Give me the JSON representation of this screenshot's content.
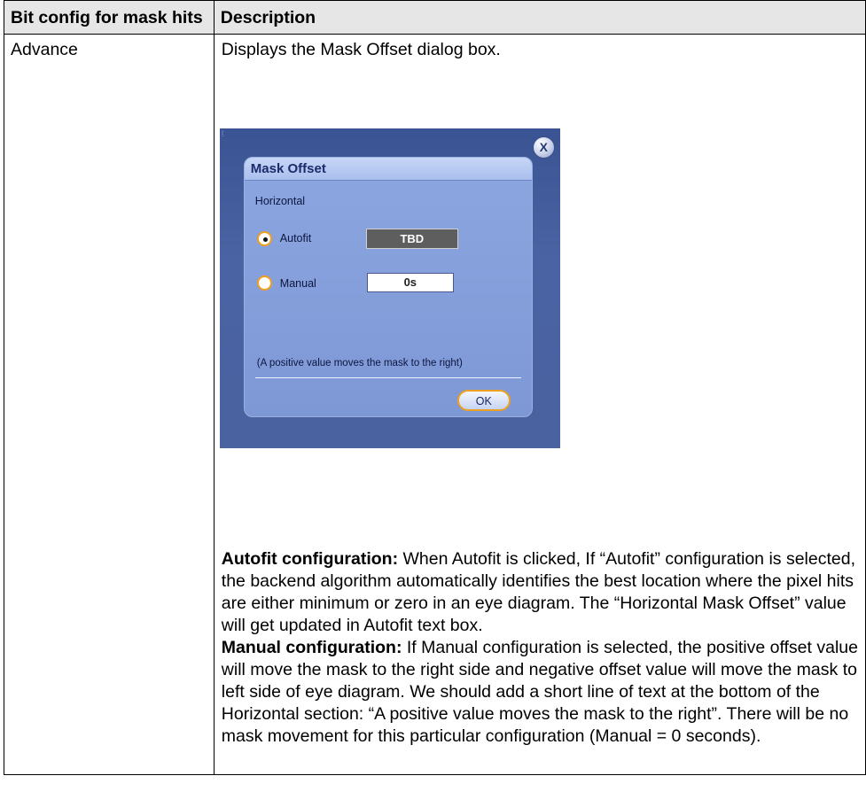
{
  "table": {
    "headers": [
      "Bit config for mask hits",
      "Description"
    ],
    "row": {
      "name": "Advance",
      "intro": "Displays the Mask Offset dialog box."
    }
  },
  "dialog": {
    "title": "Mask Offset",
    "section_label": "Horizontal",
    "autofit_label": "Autofit",
    "autofit_selected": true,
    "autofit_value": "TBD",
    "manual_label": "Manual",
    "manual_selected": false,
    "manual_value": "0s",
    "hint": "(A positive value moves the mask to the right)",
    "ok_label": "OK",
    "close_label": "X",
    "colors": {
      "accent_orange": "#f0a020",
      "dialog_blue": "#8ba6e0",
      "background_blue": "#4a63a2"
    }
  },
  "description": {
    "autofit_heading": "Autofit configuration:",
    "autofit_text": " When Autofit is clicked, If “Autofit” configuration is selected, the backend algorithm automatically identifies the best location where the pixel hits are either minimum or zero in an eye diagram. The “Horizontal Mask Offset” value will get updated in Autofit text box.",
    "manual_heading": "Manual configuration:",
    "manual_text": " If Manual configuration is selected, the positive offset value will move the mask to the right side and negative offset value will move the mask to left side of eye diagram. We should add a short line of text at the bottom of the Horizontal section: “A positive value moves the mask to the right”. There will be no mask movement for this particular configuration (Manual = 0 seconds)."
  }
}
